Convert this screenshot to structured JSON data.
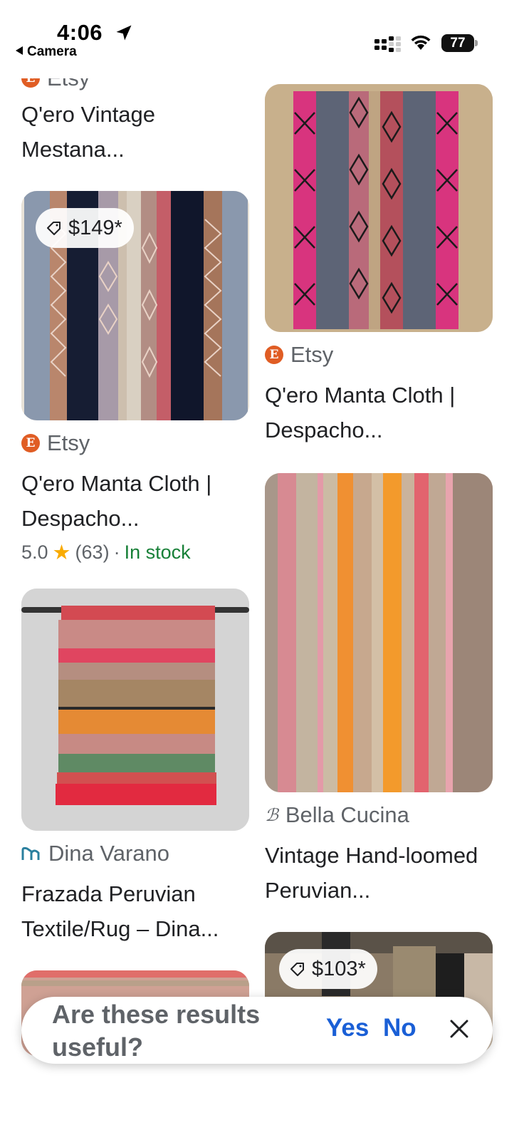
{
  "status_bar": {
    "time": "4:06",
    "back_label": "Camera",
    "battery": "77"
  },
  "results": [
    {
      "source": "Etsy",
      "title": "Q'ero Vintage Mestana..."
    },
    {
      "price": "$149*",
      "source": "Etsy",
      "title": "Q'ero Manta Cloth | Despacho...",
      "rating": "5.0",
      "reviews": "(63)",
      "separator": "·",
      "availability": "In stock"
    },
    {
      "source": "Dina Varano",
      "title": "Frazada Peruvian Textile/Rug – Dina..."
    },
    {
      "source": "Etsy",
      "title": "Q'ero Manta Cloth | Despacho..."
    },
    {
      "source": "Bella Cucina",
      "title": "Vintage Hand-loomed Peruvian..."
    },
    {
      "price": "$103*"
    }
  ],
  "feedback": {
    "question": "Are these results useful?",
    "yes_label": "Yes",
    "no_label": "No"
  },
  "colors": {
    "link_blue": "#1a5fd6",
    "stock_green": "#188038",
    "etsy_orange": "#e05d24",
    "star": "#f9ab00"
  }
}
